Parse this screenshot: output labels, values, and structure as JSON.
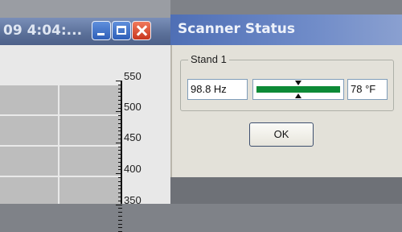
{
  "background_window": {
    "title": "09 4:04:...",
    "axis_ticks": [
      "550",
      "500",
      "450",
      "400",
      "350"
    ]
  },
  "dialog": {
    "title": "Scanner Status",
    "group_label": "Stand 1",
    "frequency_value": "98.8 Hz",
    "temperature_value": "78 °F",
    "indicator_level": 0.5,
    "ok_label": "OK"
  },
  "colors": {
    "indicator_bar": "#0d8a36",
    "titlebar": "#4f6fb5",
    "close_button": "#c8361e"
  }
}
